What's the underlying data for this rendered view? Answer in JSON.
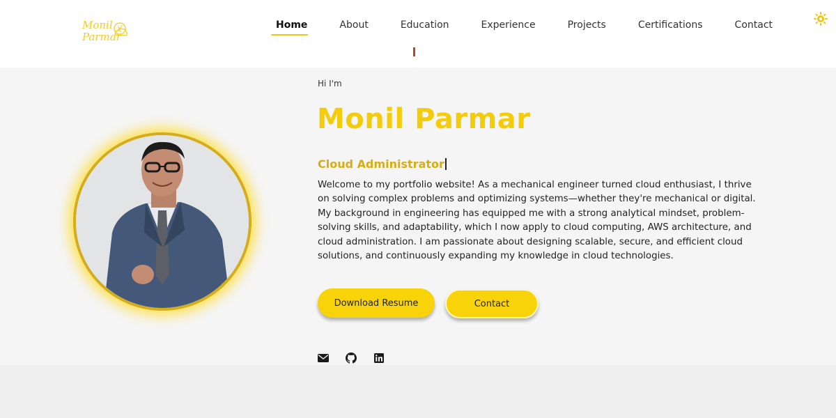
{
  "logo": {
    "line1": "Monil",
    "line2": "Parmar"
  },
  "nav": {
    "items": [
      {
        "label": "Home",
        "active": true
      },
      {
        "label": "About"
      },
      {
        "label": "Education"
      },
      {
        "label": "Experience"
      },
      {
        "label": "Projects"
      },
      {
        "label": "Certifications"
      },
      {
        "label": "Contact"
      }
    ],
    "theme_icon": "sun-icon"
  },
  "hero": {
    "greeting": "Hi I'm",
    "name": "Monil Parmar",
    "role": "Cloud Administrator",
    "bio": "Welcome to my portfolio website! As a mechanical engineer turned cloud enthusiast, I thrive on solving complex problems and optimizing systems—whether they're mechanical or digital. My background in engineering has equipped me with a strong analytical mindset, problem-solving skills, and adaptability, which I now apply to cloud computing, AWS architecture, and cloud administration. I am passionate about designing scalable, secure, and efficient cloud solutions, and continuously expanding my knowledge in cloud technologies.",
    "buttons": {
      "resume": "Download Resume",
      "contact": "Contact"
    },
    "social": [
      "mail-icon",
      "github-icon",
      "linkedin-icon"
    ]
  },
  "colors": {
    "accent": "#f5cc0b",
    "accent_dark": "#d8ad12",
    "button": "#f8d30a"
  }
}
